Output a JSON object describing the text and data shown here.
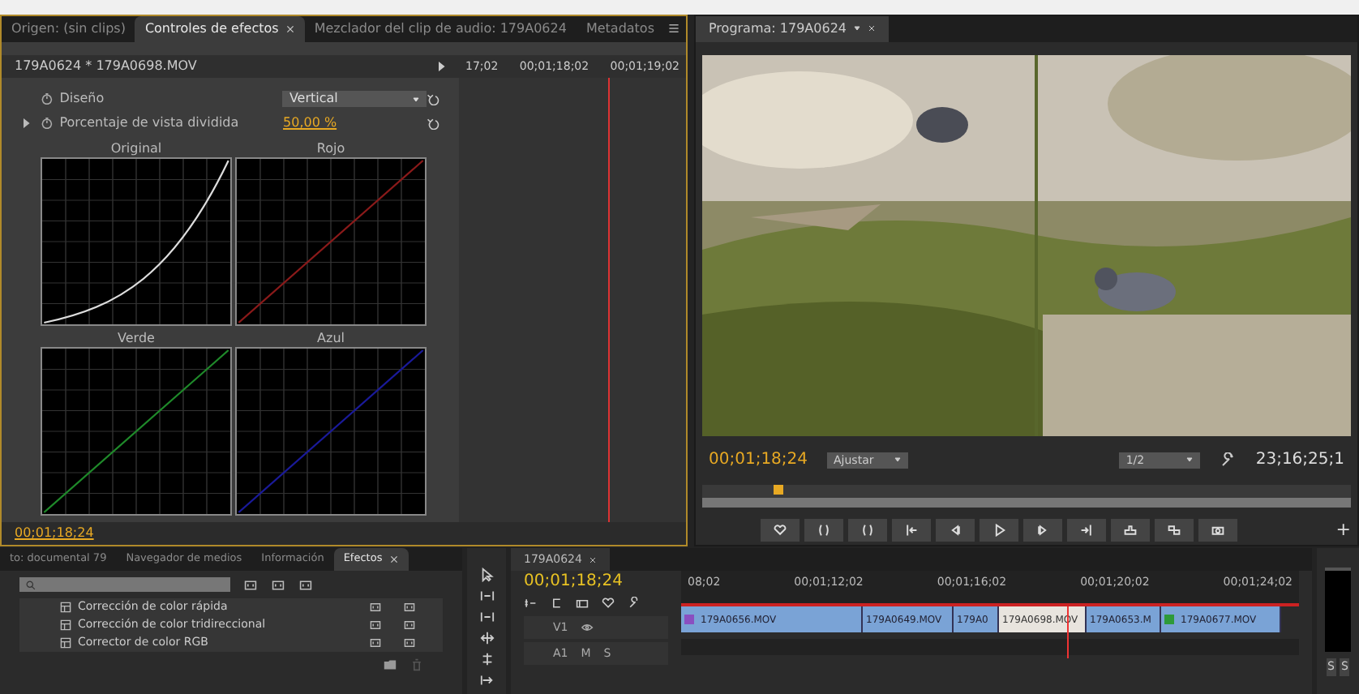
{
  "effect_panel": {
    "tabs": [
      {
        "label": "Origen: (sin clips)",
        "selected": false,
        "closable": false
      },
      {
        "label": "Controles de efectos",
        "selected": true,
        "closable": true
      },
      {
        "label": "Mezclador del clip de audio: 179A0624",
        "selected": false,
        "closable": false
      },
      {
        "label": "Metadatos",
        "selected": false,
        "closable": false
      }
    ],
    "clip_title": "179A0624 * 179A0698.MOV",
    "ruler": [
      "17;02",
      "00;01;18;02",
      "00;01;19;02"
    ],
    "properties": [
      {
        "label": "Diseño",
        "kind": "dropdown",
        "value": "Vertical",
        "expandable": false
      },
      {
        "label": "Porcentaje de vista dividida",
        "kind": "number",
        "value": "50,00 %",
        "expandable": true
      }
    ],
    "curves": [
      {
        "label": "Original",
        "kind": "curve"
      },
      {
        "label": "Rojo",
        "kind": "line",
        "color": "#8b1a1a"
      },
      {
        "label": "Verde",
        "kind": "line",
        "color": "#1f8a2a"
      },
      {
        "label": "Azul",
        "kind": "line",
        "color": "#1a1a9a"
      }
    ],
    "timecode": "00;01;18;24"
  },
  "program": {
    "tab": "Programa: 179A0624",
    "timecode": "00;01;18;24",
    "fit": "Ajustar",
    "resolution": "1/2",
    "duration": "23;16;25;1",
    "add": "+"
  },
  "effects": {
    "tabs": [
      {
        "label": "to: documental 79",
        "selected": false,
        "closable": false
      },
      {
        "label": "Navegador de medios",
        "selected": false,
        "closable": false
      },
      {
        "label": "Información",
        "selected": false,
        "closable": false
      },
      {
        "label": "Efectos",
        "selected": true,
        "closable": true
      }
    ],
    "items": [
      "Corrección de color rápida",
      "Corrección de color tridireccional",
      "Corrector de color RGB"
    ]
  },
  "timeline": {
    "tab": "179A0624",
    "timecode": "00;01;18;24",
    "ruler": [
      "08;02",
      "00;01;12;02",
      "00;01;16;02",
      "00;01;20;02",
      "00;01;24;02"
    ],
    "tracks": [
      {
        "name": "V1",
        "kind": "video"
      },
      {
        "name": "A1",
        "kind": "audio",
        "mute": "M",
        "solo": "S"
      }
    ],
    "clips": [
      {
        "name": "179A0656.MOV",
        "selected": false,
        "color": "#8a4fc0"
      },
      {
        "name": "179A0649.MOV",
        "selected": false
      },
      {
        "name": "179A0",
        "selected": false
      },
      {
        "name": "179A0698.MOV",
        "selected": true
      },
      {
        "name": "179A0653.M",
        "selected": false
      },
      {
        "name": "179A0677.MOV",
        "selected": false,
        "color": "#2e9a3a"
      }
    ]
  },
  "meter": {
    "labels": [
      "S",
      "S"
    ]
  }
}
